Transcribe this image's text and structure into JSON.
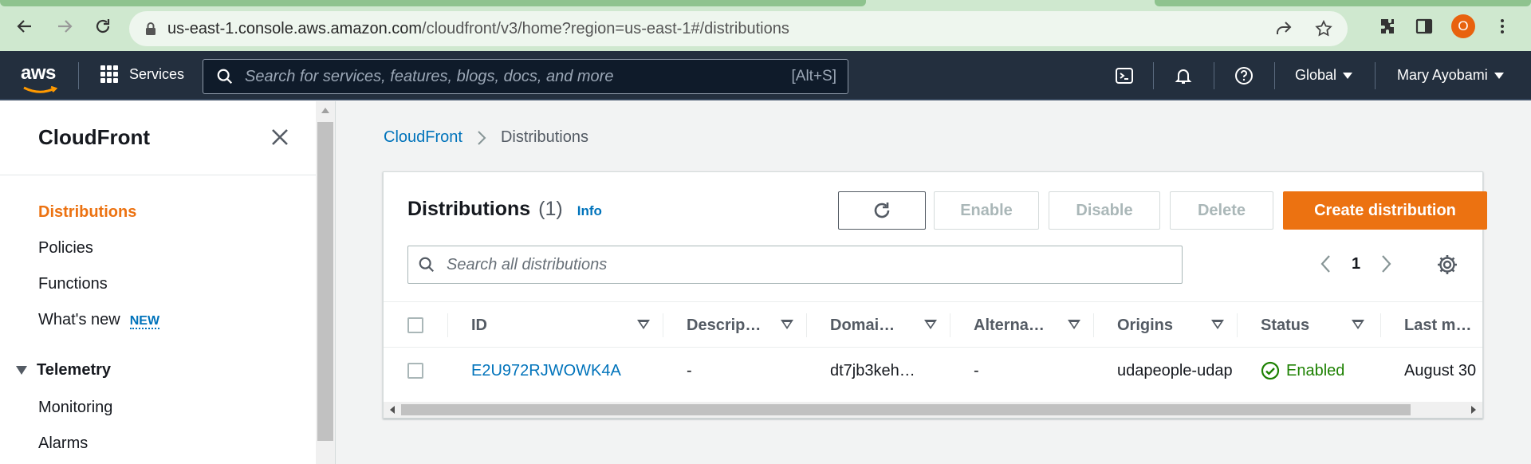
{
  "browser": {
    "url_host": "us-east-1.console.aws.amazon.com",
    "url_path": "/cloudfront/v3/home?region=us-east-1#/distributions",
    "profile_initial": "O"
  },
  "aws_nav": {
    "logo_text": "aws",
    "services_label": "Services",
    "search_placeholder": "Search for services, features, blogs, docs, and more",
    "search_shortcut": "[Alt+S]",
    "region_label": "Global",
    "user_label": "Mary Ayobami"
  },
  "sidebar": {
    "title": "CloudFront",
    "items": [
      {
        "label": "Distributions",
        "active": true
      },
      {
        "label": "Policies"
      },
      {
        "label": "Functions"
      },
      {
        "label": "What's new",
        "badge": "NEW"
      }
    ],
    "group": {
      "label": "Telemetry",
      "items": [
        {
          "label": "Monitoring"
        },
        {
          "label": "Alarms"
        }
      ]
    }
  },
  "breadcrumb": {
    "root": "CloudFront",
    "current": "Distributions"
  },
  "panel": {
    "title": "Distributions",
    "count": "(1)",
    "info_label": "Info",
    "buttons": {
      "enable": "Enable",
      "disable": "Disable",
      "delete": "Delete",
      "create": "Create distribution"
    },
    "search_placeholder": "Search all distributions",
    "page_number": "1"
  },
  "table": {
    "columns": [
      "ID",
      "Descrip…",
      "Domai…",
      "Alterna…",
      "Origins",
      "Status",
      "Last m…"
    ],
    "rows": [
      {
        "id": "E2U972RJWOWK4A",
        "description": "-",
        "domain": "dt7jb3keh…",
        "alternate": "-",
        "origins": "udapeople-udap",
        "status": "Enabled",
        "last_modified": "August 30"
      }
    ]
  },
  "colors": {
    "aws_nav_bg": "#232f3e",
    "primary_orange": "#ec7211",
    "link_blue": "#0073bb",
    "status_green": "#1d8102"
  }
}
